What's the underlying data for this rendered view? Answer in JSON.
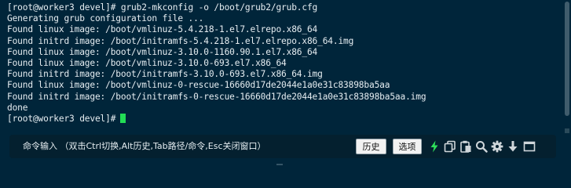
{
  "terminal": {
    "lines": [
      "[root@worker3 devel]# grub2-mkconfig -o /boot/grub2/grub.cfg",
      "Generating grub configuration file ...",
      "Found linux image: /boot/vmlinuz-5.4.218-1.el7.elrepo.x86_64",
      "Found initrd image: /boot/initramfs-5.4.218-1.el7.elrepo.x86_64.img",
      "Found linux image: /boot/vmlinuz-3.10.0-1160.90.1.el7.x86_64",
      "Found linux image: /boot/vmlinuz-3.10.0-693.el7.x86_64",
      "Found initrd image: /boot/initramfs-3.10.0-693.el7.x86_64.img",
      "Found linux image: /boot/vmlinuz-0-rescue-16660d17de2044e1a0e31c83898ba5aa",
      "Found initrd image: /boot/initramfs-0-rescue-16660d17de2044e1a0e31c83898ba5aa.img",
      "done"
    ],
    "prompt": "[root@worker3 devel]#"
  },
  "command_bar": {
    "placeholder": "命令输入 （双击Ctrl切换,Alt历史,Tab路径/命令,Esc关闭窗口）",
    "history_label": "历史",
    "options_label": "选项"
  },
  "icons": {
    "lightning": "lightning-icon",
    "copy": "copy-icon",
    "paste": "paste-icon",
    "search": "search-icon",
    "settings": "gear-icon",
    "download": "arrow-down-icon",
    "window": "window-icon"
  },
  "colors": {
    "background": "#00253a",
    "text": "#e6edf1",
    "cursor": "#22dd55",
    "lightning": "#2ee05a"
  }
}
